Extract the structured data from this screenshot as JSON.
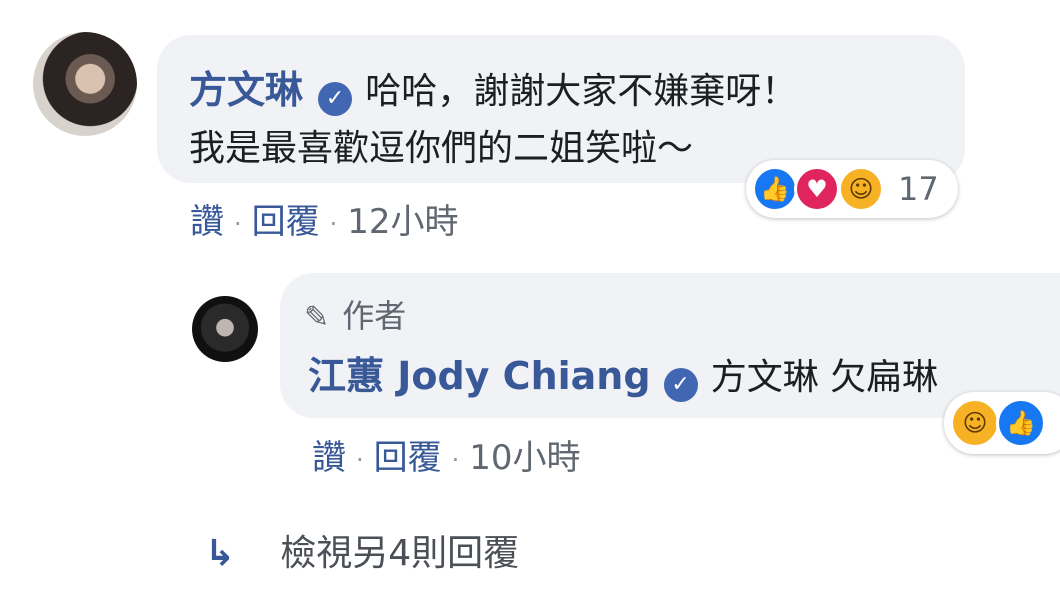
{
  "comment": {
    "author": "方文琳",
    "text_line1": "哈哈，謝謝大家不嫌棄呀！",
    "text_line2": "我是最喜歡逗你們的二姐笑啦～",
    "reaction_count": "17",
    "actions": {
      "like": "讚",
      "reply": "回覆",
      "time": "12小時"
    }
  },
  "reply": {
    "badge": "作者",
    "author": "江蕙 Jody Chiang",
    "text": "方文琳 欠扁琳",
    "actions": {
      "like": "讚",
      "reply": "回覆",
      "time": "10小時"
    }
  },
  "view_more_replies": "檢視另4則回覆",
  "colors": {
    "link": "#385898",
    "bubble": "#f0f2f5",
    "like": "#1877f2",
    "love": "#e0245e",
    "haha": "#f7b125"
  },
  "icons": [
    "verified-icon",
    "like-reaction-icon",
    "love-reaction-icon",
    "haha-reaction-icon",
    "pencil-icon",
    "reply-arrow-icon"
  ]
}
